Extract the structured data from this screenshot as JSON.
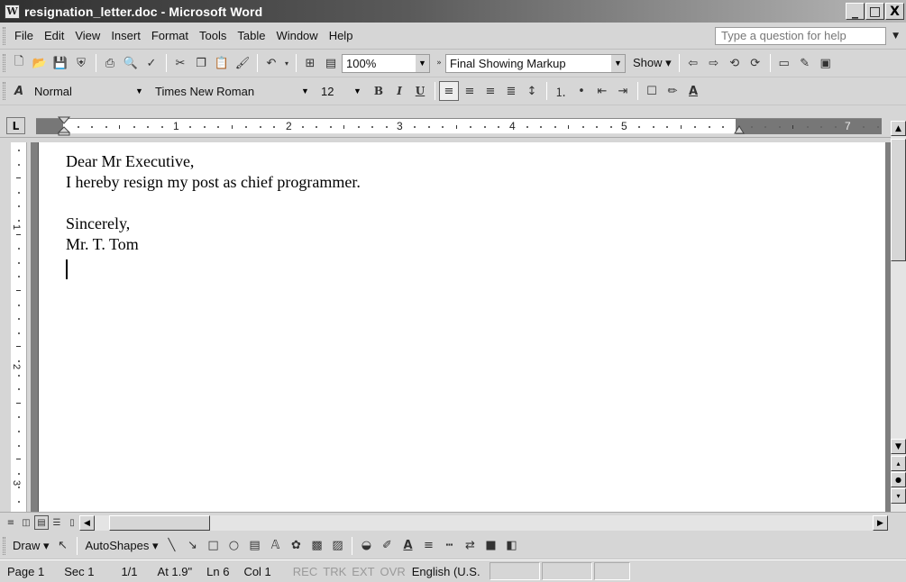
{
  "window": {
    "title": "resignation_letter.doc - Microsoft Word",
    "app_icon": "W",
    "controls": [
      "_",
      "□",
      "X"
    ]
  },
  "menubar": {
    "items": [
      "File",
      "Edit",
      "View",
      "Insert",
      "Format",
      "Tools",
      "Table",
      "Window",
      "Help"
    ],
    "help_placeholder": "Type a question for help"
  },
  "standard_toolbar": {
    "zoom": "100%",
    "markup_mode": "Final Showing Markup",
    "show_label": "Show"
  },
  "formatting_toolbar": {
    "style": "Normal",
    "font": "Times New Roman",
    "size": "12",
    "bold": "B",
    "italic": "I",
    "underline": "U"
  },
  "ruler": {
    "h_numbers": [
      "1",
      "2",
      "3",
      "4",
      "5",
      "7"
    ],
    "v_numbers": [
      "1",
      "2",
      "3"
    ],
    "tab_selector": "L"
  },
  "document": {
    "lines": [
      "Dear Mr Executive,",
      "I hereby resign my post as chief programmer.",
      "",
      "Sincerely,",
      "Mr. T. Tom"
    ]
  },
  "drawing_toolbar": {
    "draw": "Draw",
    "autoshapes": "AutoShapes"
  },
  "statusbar": {
    "page": "Page 1",
    "section": "Sec 1",
    "pages": "1/1",
    "at": "At 1.9\"",
    "line": "Ln 6",
    "col": "Col 1",
    "rec": "REC",
    "trk": "TRK",
    "ext": "EXT",
    "ovr": "OVR",
    "language": "English (U.S."
  },
  "colors": {
    "chrome": "#d6d6d6",
    "titlebar_dark": "#303030",
    "page": "#ffffff",
    "doc_background": "#7f7f7f"
  }
}
